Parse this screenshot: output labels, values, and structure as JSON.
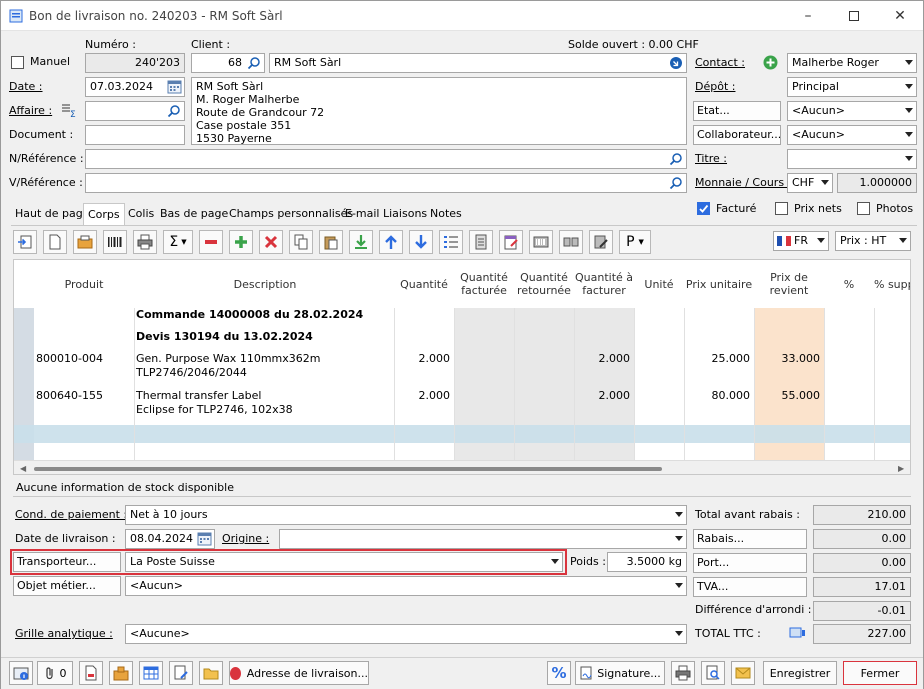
{
  "window": {
    "title": "Bon de livraison no. 240203 - RM Soft Sàrl"
  },
  "header": {
    "manual_label": "Manuel",
    "numero_label": "Numéro :",
    "numero_value": "240'203",
    "client_label": "Client :",
    "client_id": "68",
    "client_name": "RM Soft Sàrl",
    "solde_label": "Solde ouvert : 0.00 CHF",
    "date_label": "Date :",
    "date_value": "07.03.2024",
    "affaire_label": "Affaire :",
    "document_label": "Document :",
    "address_lines": [
      "RM Soft Sàrl",
      "M. Roger Malherbe",
      "Route de Grandcour 72",
      "Case postale 351",
      "1530 Payerne"
    ],
    "nref_label": "N/Référence :",
    "vref_label": "V/Référence :",
    "contact_label": "Contact :",
    "contact_value": "Malherbe Roger",
    "depot_label": "Dépôt :",
    "depot_value": "Principal",
    "etat_label": "Etat...",
    "etat_value": "<Aucun>",
    "collab_label": "Collaborateur...",
    "collab_value": "<Aucun>",
    "titre_label": "Titre :",
    "titre_value": "",
    "monnaie_label": "Monnaie / Cours :",
    "monnaie_value": "CHF",
    "cours_value": "1.000000"
  },
  "tabs": [
    "Haut de page",
    "Corps",
    "Colis",
    "Bas de page",
    "Champs personnalisés",
    "E-mail",
    "Liaisons",
    "Notes"
  ],
  "options": {
    "facture": "Facturé",
    "prix_nets": "Prix nets",
    "photos": "Photos"
  },
  "toolbar": {
    "lang": "FR",
    "prix": "Prix : HT",
    "p_label": "P"
  },
  "grid": {
    "headers": [
      "Produit",
      "Description",
      "Quantité",
      "Quantité facturée",
      "Quantité retournée",
      "Quantité à facturer",
      "Unité",
      "Prix unitaire",
      "Prix de revient",
      "%",
      "% supp"
    ],
    "rows": [
      {
        "produit": "",
        "desc": "Commande 14000008 du 28.02.2024",
        "qte": "",
        "qaf": "",
        "pu": "",
        "pr": ""
      },
      {
        "produit": "",
        "desc": "Devis 130194 du 13.02.2024",
        "qte": "",
        "qaf": "",
        "pu": "",
        "pr": ""
      },
      {
        "produit": "800010-004",
        "desc": "Gen. Purpose Wax 110mmx362m",
        "desc2": "TLP2746/2046/2044",
        "qte": "2.000",
        "qaf": "2.000",
        "pu": "25.000",
        "pr": "33.000"
      },
      {
        "produit": "800640-155",
        "desc": "Thermal transfer Label",
        "desc2": "Eclipse for TLP2746, 102x38",
        "qte": "2.000",
        "qaf": "2.000",
        "pu": "80.000",
        "pr": "55.000"
      }
    ]
  },
  "stock_info": "Aucune information de stock disponible",
  "bottom": {
    "cond_label": "Cond. de paiement :",
    "cond_value": "Net à 10 jours",
    "date_liv_label": "Date de livraison :",
    "date_liv_value": "08.04.2024",
    "origine_label": "Origine :",
    "transporteur_label": "Transporteur...",
    "transporteur_value": "La Poste Suisse",
    "poids_label": "Poids :",
    "poids_value": "3.5000 kg",
    "objet_label": "Objet métier...",
    "objet_value": "<Aucun>",
    "grille_label": "Grille analytique :",
    "grille_value": "<Aucune>"
  },
  "totals": {
    "total_avant_label": "Total avant rabais :",
    "total_avant_value": "210.00",
    "rabais_label": "Rabais...",
    "rabais_value": "0.00",
    "port_label": "Port...",
    "port_value": "0.00",
    "tva_label": "TVA...",
    "tva_value": "17.01",
    "diff_label": "Différence d'arrondi :",
    "diff_value": "-0.01",
    "ttc_label": "TOTAL TTC :",
    "ttc_value": "227.00"
  },
  "footer": {
    "attach_count": "0",
    "adresse_label": "Adresse de livraison...",
    "signature_label": "Signature...",
    "enregistrer_label": "Enregistrer",
    "fermer_label": "Fermer"
  },
  "colors": {
    "accent": "#2d6cdf",
    "highlight_red": "#d9343d",
    "revient_bg": "#fbe3cc",
    "selected_row": "#c9dfea"
  }
}
